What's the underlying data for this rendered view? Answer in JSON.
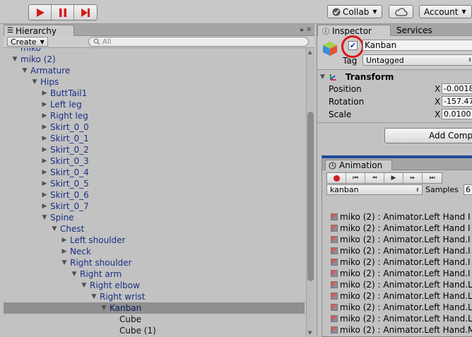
{
  "toolbar": {
    "collab_label": "Collab",
    "account_label": "Account"
  },
  "hierarchy": {
    "tab_label": "Hierarchy",
    "create_label": "Create",
    "search_placeholder": "All",
    "items": [
      {
        "label": "miko",
        "depth": 1,
        "arrow": "none",
        "style": "partial"
      },
      {
        "label": "miko (2)",
        "depth": 1,
        "arrow": "open"
      },
      {
        "label": "Armature",
        "depth": 2,
        "arrow": "open"
      },
      {
        "label": "Hips",
        "depth": 3,
        "arrow": "open"
      },
      {
        "label": "ButtTail1",
        "depth": 4,
        "arrow": "closed"
      },
      {
        "label": "Left leg",
        "depth": 4,
        "arrow": "closed"
      },
      {
        "label": "Right leg",
        "depth": 4,
        "arrow": "closed"
      },
      {
        "label": "Skirt_0_0",
        "depth": 4,
        "arrow": "closed"
      },
      {
        "label": "Skirt_0_1",
        "depth": 4,
        "arrow": "closed"
      },
      {
        "label": "Skirt_0_2",
        "depth": 4,
        "arrow": "closed"
      },
      {
        "label": "Skirt_0_3",
        "depth": 4,
        "arrow": "closed"
      },
      {
        "label": "Skirt_0_4",
        "depth": 4,
        "arrow": "closed"
      },
      {
        "label": "Skirt_0_5",
        "depth": 4,
        "arrow": "closed"
      },
      {
        "label": "Skirt_0_6",
        "depth": 4,
        "arrow": "closed"
      },
      {
        "label": "Skirt_0_7",
        "depth": 4,
        "arrow": "closed"
      },
      {
        "label": "Spine",
        "depth": 4,
        "arrow": "open"
      },
      {
        "label": "Chest",
        "depth": 5,
        "arrow": "open"
      },
      {
        "label": "Left shoulder",
        "depth": 6,
        "arrow": "closed"
      },
      {
        "label": "Neck",
        "depth": 6,
        "arrow": "closed"
      },
      {
        "label": "Right shoulder",
        "depth": 6,
        "arrow": "open"
      },
      {
        "label": "Right arm",
        "depth": 7,
        "arrow": "open"
      },
      {
        "label": "Right elbow",
        "depth": 8,
        "arrow": "open"
      },
      {
        "label": "Right wrist",
        "depth": 9,
        "arrow": "open"
      },
      {
        "label": "Kanban",
        "depth": 10,
        "arrow": "open",
        "selected": true
      },
      {
        "label": "Cube",
        "depth": 11,
        "arrow": "none",
        "style": "black"
      },
      {
        "label": "Cube (1)",
        "depth": 11,
        "arrow": "none",
        "style": "black"
      }
    ]
  },
  "inspector": {
    "tab_label": "Inspector",
    "services_label": "Services",
    "object_name": "Kanban",
    "tag_label": "Tag",
    "tag_value": "Untagged",
    "transform_label": "Transform",
    "position_label": "Position",
    "rotation_label": "Rotation",
    "scale_label": "Scale",
    "axis_x": "X",
    "position_x": "-0.0018",
    "rotation_x": "-157.47",
    "scale_x": "0.0100",
    "add_component_label": "Add Comp"
  },
  "animation": {
    "tab_label": "Animation",
    "clip_name": "kanban",
    "samples_label": "Samples",
    "samples_value": "6",
    "properties": [
      "miko (2) : Animator.Left Hand I",
      "miko (2) : Animator.Left Hand I",
      "miko (2) : Animator.Left Hand.I",
      "miko (2) : Animator.Left Hand.I",
      "miko (2) : Animator.Left Hand.I",
      "miko (2) : Animator.Left Hand.I",
      "miko (2) : Animator.Left Hand.L",
      "miko (2) : Animator.Left Hand.L",
      "miko (2) : Animator.Left Hand.L",
      "miko (2) : Animator.Left Hand.L",
      "miko (2) : Animator.Left Hand.M"
    ]
  }
}
